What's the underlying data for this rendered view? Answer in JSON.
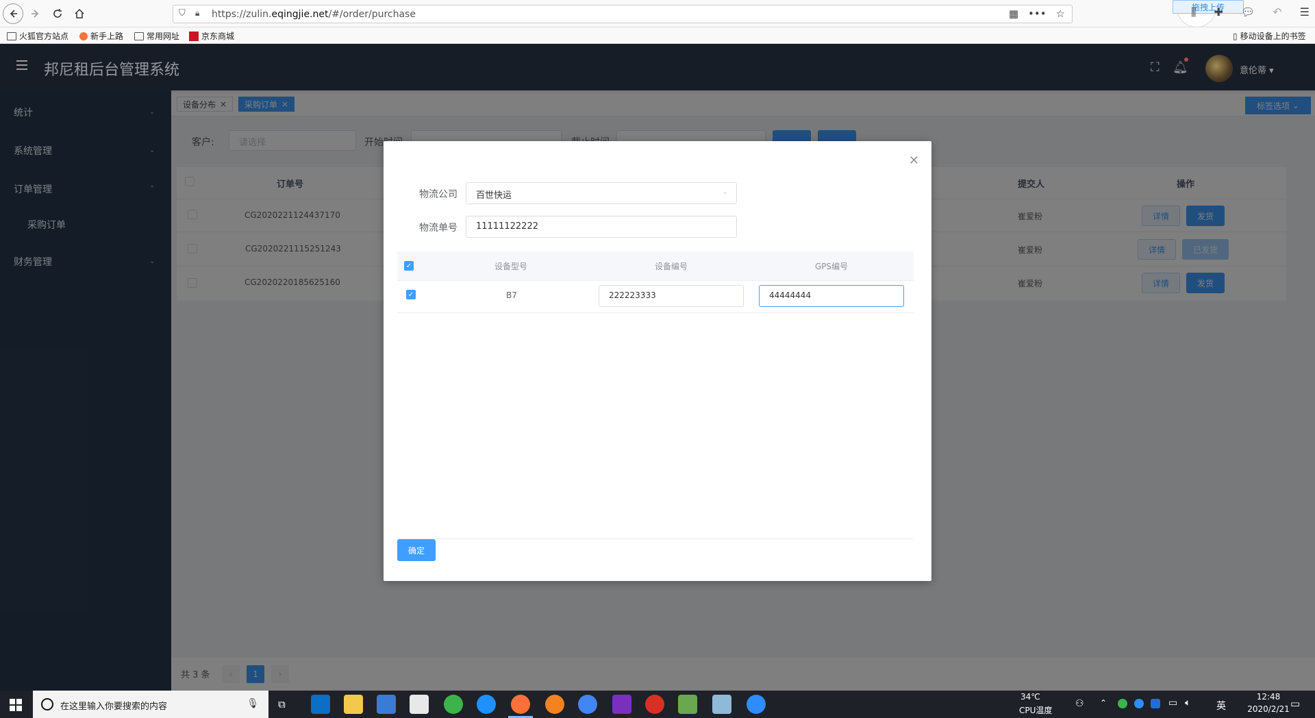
{
  "browser": {
    "url_prefix": "https://zulin.",
    "url_domain": "eqingjie.net",
    "url_suffix": "/#/order/purchase",
    "upload_label": "拖拽上传",
    "bookmarks": [
      "火狐官方站点",
      "新手上路",
      "常用网址",
      "京东商城"
    ],
    "mobile_bookmarks": "移动设备上的书签"
  },
  "header": {
    "title": "邦尼租后台管理系统",
    "user_name": "意伦蒂"
  },
  "sidebar": {
    "items": [
      {
        "label": "统计"
      },
      {
        "label": "系统管理"
      },
      {
        "label": "订单管理"
      },
      {
        "label": "采购订单"
      },
      {
        "label": "财务管理"
      }
    ]
  },
  "tags": {
    "items": [
      {
        "label": "设备分布"
      },
      {
        "label": "采购订单"
      }
    ],
    "options_label": "标签选项"
  },
  "filters": {
    "customer_label": "客户:",
    "customer_placeholder": "请选择",
    "start_label": "开始时间",
    "end_label": "截止时间"
  },
  "table": {
    "headers": {
      "order_no": "订单号",
      "submitter": "提交人",
      "actions": "操作"
    },
    "rows": [
      {
        "order_no": "CG2020221124437170",
        "submitter": "崔爱粉",
        "detail": "详情",
        "ship": "发货"
      },
      {
        "order_no": "CG2020221115251243",
        "submitter": "崔爱粉",
        "detail": "详情",
        "ship": "已发货"
      },
      {
        "order_no": "CG2020220185625160",
        "submitter": "崔爱粉",
        "detail": "详情",
        "ship": "发货"
      }
    ]
  },
  "pager": {
    "total": "共 3 条",
    "current": "1"
  },
  "dialog": {
    "logistics_company_label": "物流公司",
    "logistics_company_value": "百世快运",
    "tracking_no_label": "物流单号",
    "tracking_no_value": "11111122222",
    "columns": {
      "model": "设备型号",
      "device_no": "设备编号",
      "gps_no": "GPS编号"
    },
    "rows": [
      {
        "model": "B7",
        "device_no": "222223333",
        "gps_no": "44444444"
      }
    ],
    "confirm_label": "确定"
  },
  "taskbar": {
    "search_placeholder": "在这里输入你要搜索的内容",
    "temperature": "34℃",
    "temp_label": "CPU温度",
    "ime": "英",
    "time": "12:48",
    "date": "2020/2/21"
  },
  "colors": {
    "primary": "#409eff",
    "header_bg": "#222a38",
    "sidebar_bg": "#1f2d3d"
  }
}
